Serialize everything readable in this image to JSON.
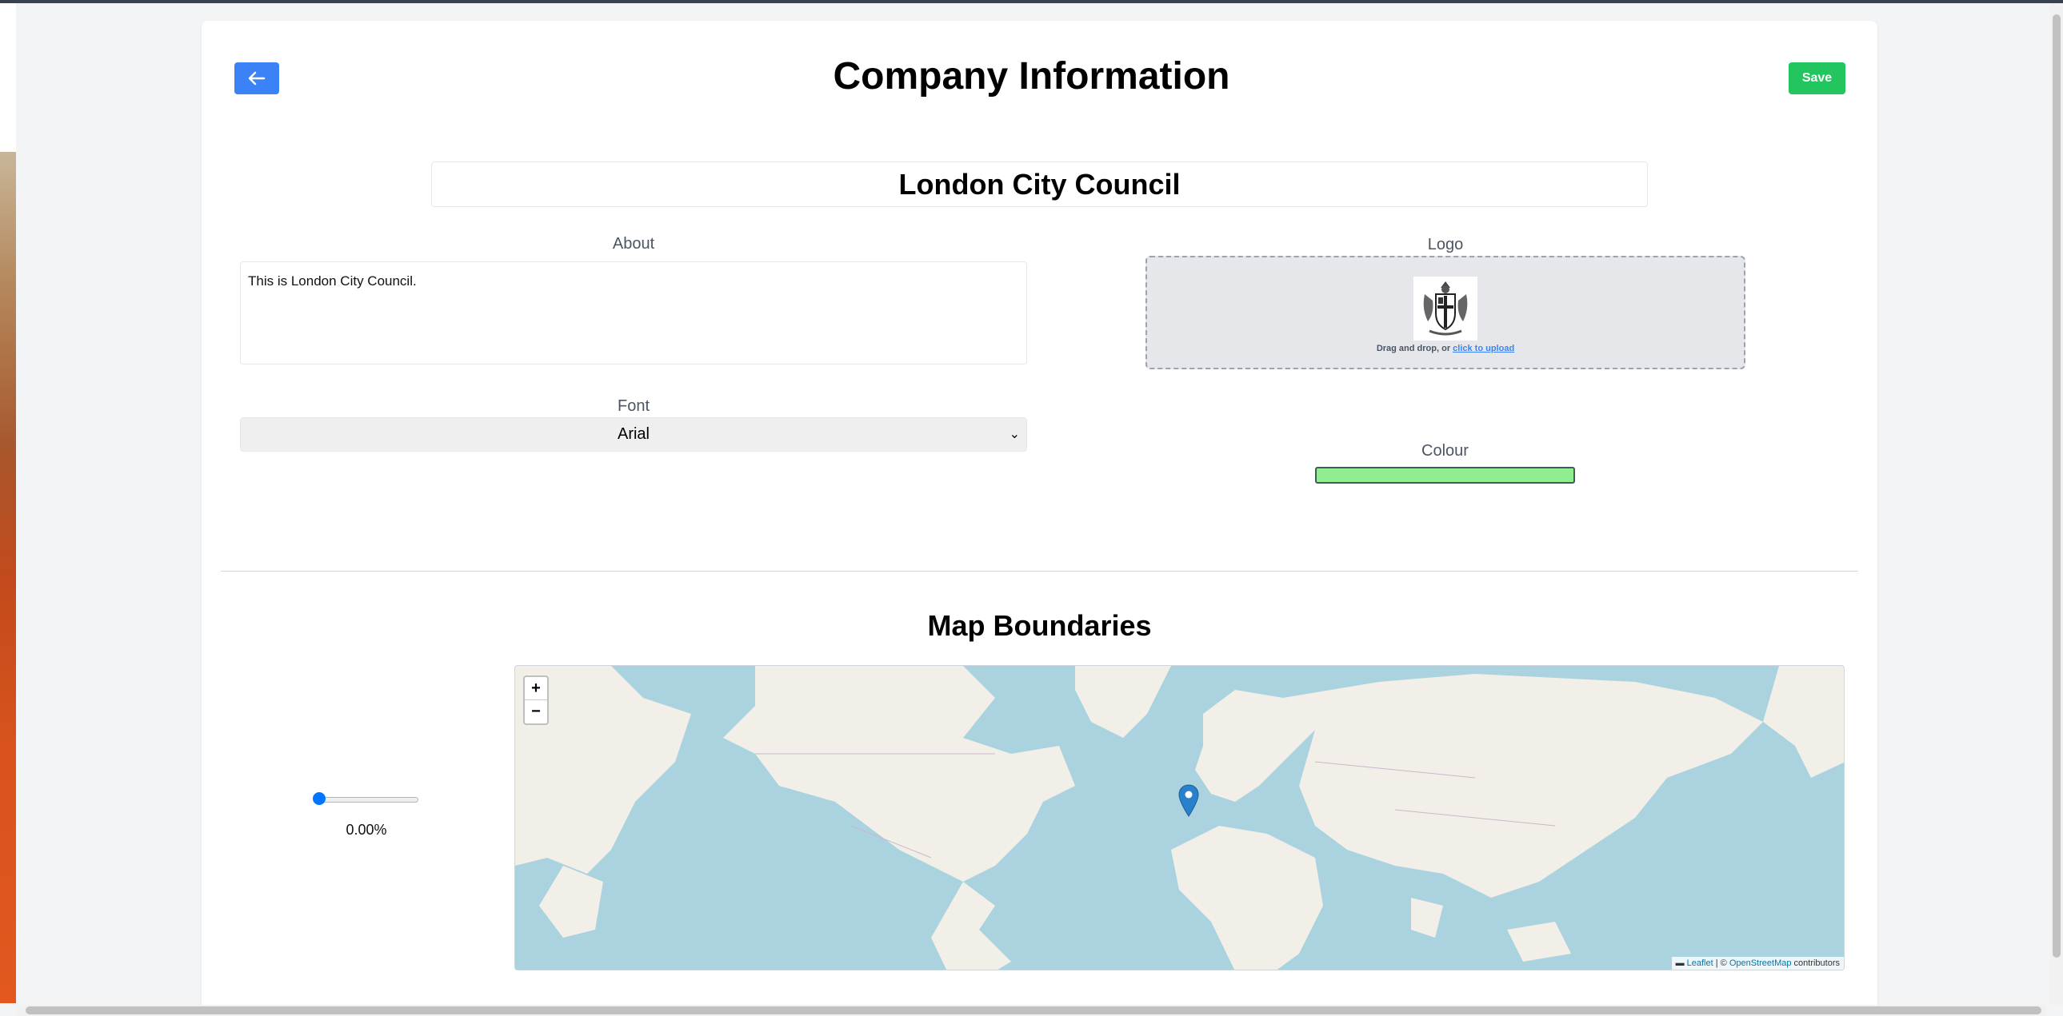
{
  "header": {
    "title": "Company Information",
    "back_icon": "arrow-left-icon",
    "save_label": "Save"
  },
  "company": {
    "name": "London City Council"
  },
  "about": {
    "label": "About",
    "value": "This is London City Council."
  },
  "font": {
    "label": "Font",
    "selected": "Arial"
  },
  "logo": {
    "label": "Logo",
    "drop_text": "Drag and drop, or ",
    "upload_link": "click to upload"
  },
  "colour": {
    "label": "Colour",
    "value": "#90ee90"
  },
  "map_section": {
    "title": "Map Boundaries",
    "slider_value": 0,
    "slider_label": "0.00%",
    "zoom_in": "+",
    "zoom_out": "−",
    "attribution_leaflet": "Leaflet",
    "attribution_sep": " | © ",
    "attribution_osm": "OpenStreetMap",
    "attribution_suffix": " contributors",
    "marker_icon": "map-marker-icon"
  },
  "colors": {
    "back_button": "#3b82f6",
    "save_button": "#22c55e",
    "ocean": "#aad3df",
    "land": "#f2efe9",
    "marker": "#2a81cb"
  }
}
